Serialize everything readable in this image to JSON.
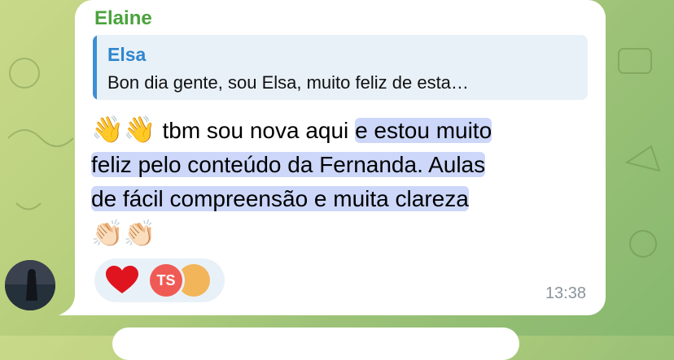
{
  "message": {
    "sender": "Elaine",
    "reply": {
      "name": "Elsa",
      "text": "Bon dia gente, sou Elsa, muito feliz de esta…"
    },
    "emoji_wave": "👋👋",
    "text_plain": " tbm sou nova aqui ",
    "text_highlighted_1": "e estou muito",
    "text_highlighted_2": "feliz pelo conteúdo da Fernanda. Aulas",
    "text_highlighted_3": "de fácil compreensão e muita clareza",
    "emoji_clap": "👏🏻👏🏻",
    "time": "13:38",
    "reactions": {
      "heart_icon": "heart-icon",
      "avatar_ts_initials": "TS",
      "avatar_ts_color": "#f05a55",
      "avatar_l_color": "#f3b55a"
    }
  },
  "colors": {
    "sender": "#4aa33c",
    "reply_name": "#2f86cf",
    "reply_bar": "#3d8fd4",
    "highlight": "#7896f0"
  }
}
